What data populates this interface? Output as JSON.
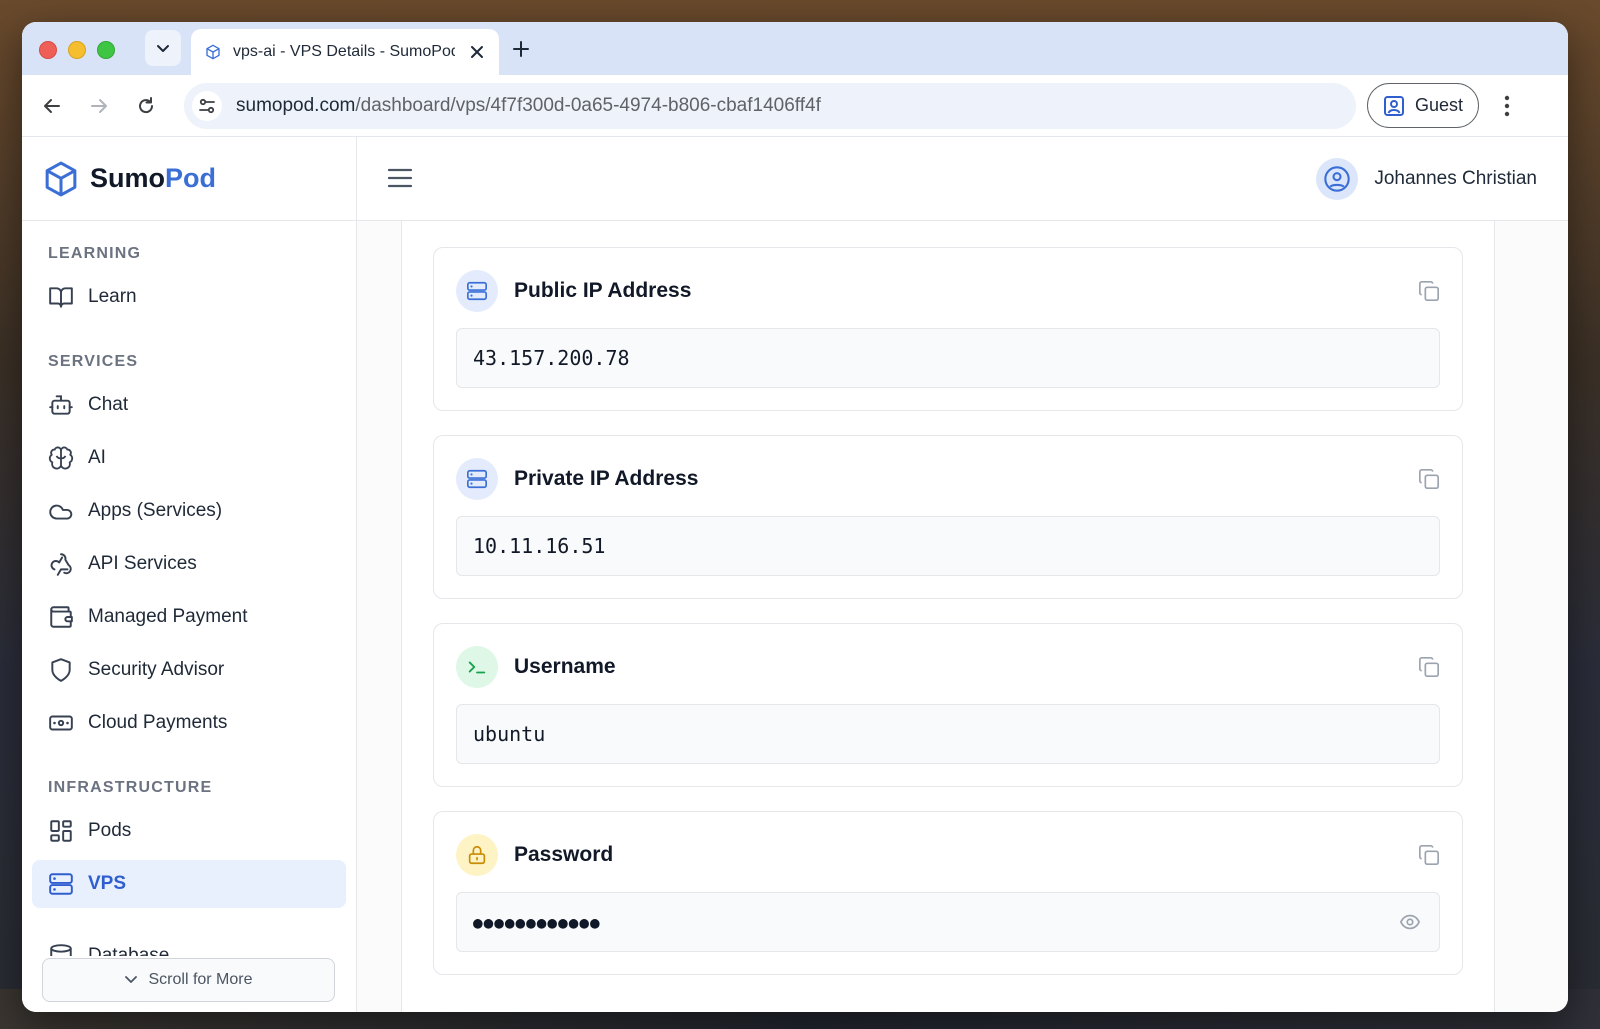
{
  "browser": {
    "tab_title": "vps-ai - VPS Details - SumoPod",
    "url_host": "sumopod.com",
    "url_path": "/dashboard/vps/4f7f300d-0a65-4974-b806-cbaf1406ff4f",
    "profile_label": "Guest"
  },
  "brand": {
    "name_part1": "Sumo",
    "name_part2": "Pod",
    "accent_color": "#3b6fd6"
  },
  "sidebar": {
    "sections": [
      {
        "label": "LEARNING",
        "items": [
          {
            "label": "Learn",
            "icon": "book-icon"
          }
        ]
      },
      {
        "label": "SERVICES",
        "items": [
          {
            "label": "Chat",
            "icon": "bot-icon"
          },
          {
            "label": "AI",
            "icon": "brain-icon"
          },
          {
            "label": "Apps (Services)",
            "icon": "cloud-icon"
          },
          {
            "label": "API Services",
            "icon": "webhook-icon"
          },
          {
            "label": "Managed Payment",
            "icon": "wallet-icon"
          },
          {
            "label": "Security Advisor",
            "icon": "shield-icon"
          },
          {
            "label": "Cloud Payments",
            "icon": "banknote-icon"
          }
        ]
      },
      {
        "label": "INFRASTRUCTURE",
        "items": [
          {
            "label": "Pods",
            "icon": "layout-icon"
          },
          {
            "label": "VPS",
            "icon": "server-icon",
            "active": true
          }
        ]
      }
    ],
    "partial_item": "Database",
    "scroll_more": "Scroll for More"
  },
  "header": {
    "user_name": "Johannes Christian"
  },
  "cards": {
    "public_ip": {
      "title": "Public IP Address",
      "value": "43.157.200.78",
      "icon": "server-icon"
    },
    "private_ip": {
      "title": "Private IP Address",
      "value": "10.11.16.51",
      "icon": "server-icon"
    },
    "username": {
      "title": "Username",
      "value": "ubuntu",
      "icon": "terminal-icon"
    },
    "password": {
      "title": "Password",
      "value": "●●●●●●●●●●●●",
      "icon": "lock-icon"
    }
  }
}
